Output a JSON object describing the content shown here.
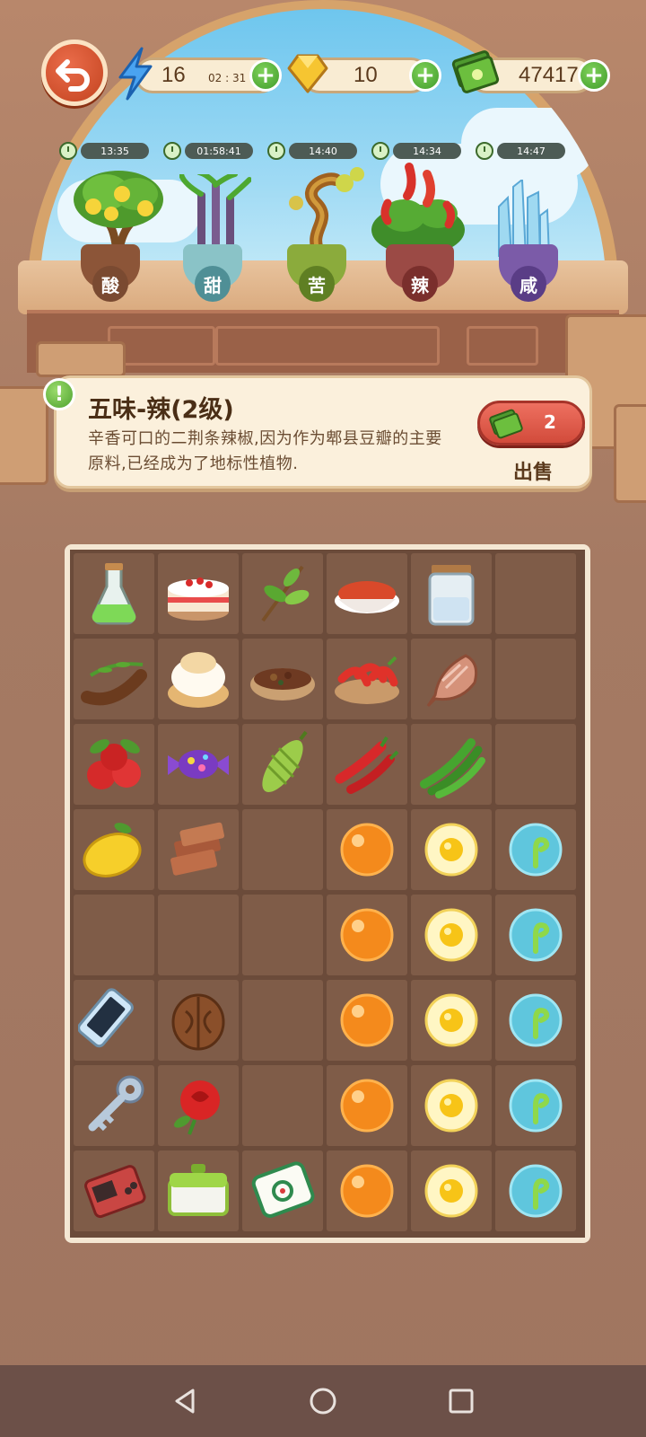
{
  "hud": {
    "energy": "16",
    "energy_timer": "02 : 31",
    "gems": "10",
    "cash": "47417"
  },
  "plants": [
    {
      "label": "酸",
      "timer": "13:35",
      "pot_color": "#8c5538",
      "label_bg": "#7a4a31"
    },
    {
      "label": "甜",
      "timer": "01:58:41",
      "pot_color": "#8ac3c7",
      "label_bg": "#4f8f96"
    },
    {
      "label": "苦",
      "timer": "14:40",
      "pot_color": "#8bab3c",
      "label_bg": "#5f7f23"
    },
    {
      "label": "辣",
      "timer": "14:34",
      "pot_color": "#9b4a45",
      "label_bg": "#7a2f2c"
    },
    {
      "label": "咸",
      "timer": "14:47",
      "pot_color": "#7b5ba8",
      "label_bg": "#5a3d86"
    }
  ],
  "info": {
    "title": "五味-辣(2级)",
    "description": "辛香可口的二荆条辣椒,因为作为郫县豆瓣的主要原料,已经成为了地标性植物.",
    "sell_count": "2",
    "sell_label": "出售"
  },
  "board": [
    [
      "potion",
      "cake",
      "tea-leaves",
      "chili-powder",
      "salt-jar",
      null
    ],
    [
      "tamarind",
      "cream-puff",
      "spice-bowl",
      "chili-bowl",
      "dried-fish",
      null
    ],
    [
      "hawthorn",
      "candy",
      "bitter-melon",
      "red-chili",
      "green-chili",
      null
    ],
    [
      "lemon",
      "brown-sugar",
      null,
      "orange-orb",
      "yellow-orb",
      "blue-orb"
    ],
    [
      null,
      null,
      null,
      "orange-orb",
      "yellow-orb",
      "blue-orb"
    ],
    [
      "phone",
      "walnut",
      null,
      "orange-orb",
      "yellow-orb",
      "blue-orb"
    ],
    [
      "key",
      "rose",
      null,
      "orange-orb",
      "yellow-orb",
      "blue-orb"
    ],
    [
      "gameboy",
      "lunchbox",
      "mahjong-tile",
      "orange-orb",
      "yellow-orb",
      "blue-orb"
    ]
  ]
}
